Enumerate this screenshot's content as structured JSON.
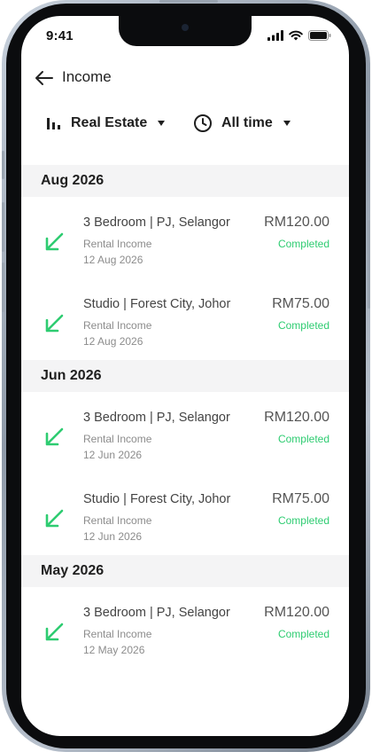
{
  "status_bar": {
    "time": "9:41",
    "icons": [
      "signal-icon",
      "wifi-icon",
      "battery-icon"
    ]
  },
  "header": {
    "back_icon": "arrow-left-icon",
    "title": "Income"
  },
  "filters": {
    "property": {
      "icon": "bar-chart-icon",
      "label": "Real Estate",
      "caret": "caret-down-icon"
    },
    "period": {
      "icon": "clock-icon",
      "label": "All time",
      "caret": "caret-down-icon"
    }
  },
  "colors": {
    "accent_green": "#2ecc71",
    "section_bg": "#f4f4f5",
    "text_primary": "#1f1f1f",
    "text_secondary": "#8c8c8c"
  },
  "groups": [
    {
      "month": "Aug 2026",
      "items": [
        {
          "name": "3 Bedroom | PJ, Selangor",
          "type": "Rental Income",
          "date": "12 Aug 2026",
          "amount": "RM120.00",
          "status": "Completed",
          "icon": "arrow-down-left-icon"
        },
        {
          "name": "Studio | Forest City, Johor",
          "type": "Rental Income",
          "date": "12 Aug 2026",
          "amount": "RM75.00",
          "status": "Completed",
          "icon": "arrow-down-left-icon"
        }
      ]
    },
    {
      "month": "Jun 2026",
      "items": [
        {
          "name": "3 Bedroom | PJ, Selangor",
          "type": "Rental Income",
          "date": "12 Jun 2026",
          "amount": "RM120.00",
          "status": "Completed",
          "icon": "arrow-down-left-icon"
        },
        {
          "name": "Studio | Forest City, Johor",
          "type": "Rental Income",
          "date": "12 Jun 2026",
          "amount": "RM75.00",
          "status": "Completed",
          "icon": "arrow-down-left-icon"
        }
      ]
    },
    {
      "month": "May 2026",
      "items": [
        {
          "name": "3 Bedroom | PJ, Selangor",
          "type": "Rental Income",
          "date": "12 May 2026",
          "amount": "RM120.00",
          "status": "Completed",
          "icon": "arrow-down-left-icon"
        }
      ]
    }
  ]
}
